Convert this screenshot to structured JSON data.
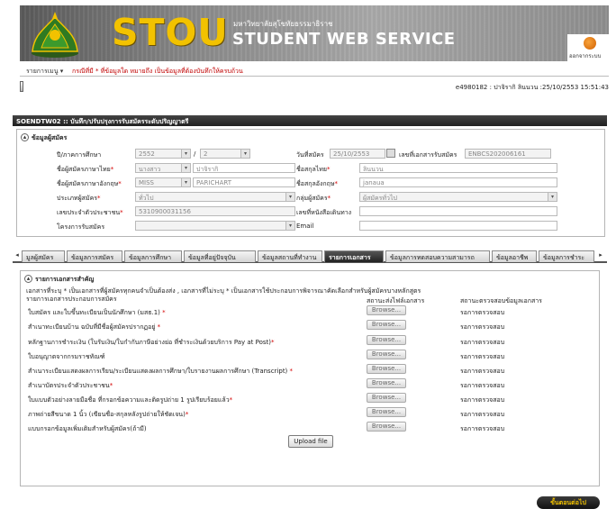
{
  "header": {
    "logo_text": "STOU",
    "university_th": "มหาวิทยาลัยสุโขทัยธรรมาธิราช",
    "service_title": "STUDENT WEB SERVICE",
    "logout_label": "ออกจากระบบ"
  },
  "menu": {
    "label": "รายการเมนู",
    "note": "กรณีที่มี * ที่ข้อมูลใด หมายถึง เป็นข้อมูลที่ต้องบันทึกให้ครบถ้วน"
  },
  "user_line": "e4980182 : ปาจิรากิ ลินนวน :25/10/2553 15:51:43",
  "page_title": "SOENDTW02 :: บันทึก/ปรับปรุงการรับสมัครระดับปริญญาตรี",
  "applicant": {
    "section_title": "ข้อมูลผู้สมัคร",
    "fields": {
      "academic_year_label": "ปี/ภาคการศึกษา",
      "academic_year_value": "2552",
      "semester_value": "2",
      "apply_date_label": "วันที่สมัคร",
      "apply_date_value": "25/10/2553",
      "doc_no_label": "เลขที่เอกสารรับสมัคร",
      "doc_no_value": "ENBCS202006161",
      "name_th_label": "ชื่อผู้สมัครภาษาไทย",
      "title_th_value": "นางสาว",
      "name_th_value": "ปาจิรากิ",
      "surname_th_label": "ชื่อสกุลไทย",
      "surname_th_value": "ลินนวน",
      "name_en_label": "ชื่อผู้สมัครภาษาอังกฤษ",
      "title_en_value": "MISS",
      "name_en_value": "PARICHART",
      "surname_en_label": "ชื่อสกุลอังกฤษ",
      "surname_en_value": "janaua",
      "type_label": "ประเภทผู้สมัคร",
      "type_value": "ทั่วไป",
      "group_label": "กลุ่มผู้สมัคร",
      "group_value": "ผู้สมัครทั่วไป",
      "id_label": "เลขประจำตัวประชาชน",
      "id_value": "5310900031156",
      "passport_label": "เลขที่หนังสือเดินทาง",
      "project_label": "โครงการรับสมัคร",
      "email_label": "Email"
    }
  },
  "tabs": [
    {
      "label": "มูลผู้สมัคร"
    },
    {
      "label": "ข้อมูลการสมัคร"
    },
    {
      "label": "ข้อมูลการศึกษา"
    },
    {
      "label": "ข้อมูลที่อยู่ปัจจุบัน"
    },
    {
      "label": "ข้อมูลสถานที่ทำงาน"
    },
    {
      "label": "รายการเอกสาร"
    },
    {
      "label": "ข้อมูลการทดสอบความสามารถ"
    },
    {
      "label": "ข้อมูลอาชีพ"
    },
    {
      "label": "ข้อมูลการชำระ"
    }
  ],
  "documents": {
    "section_title": "รายการเอกสารสำคัญ",
    "note": "เอกสารที่ระบุ * เป็นเอกสารที่ผู้สมัครทุกคนจำเป็นต้องส่ง , เอกสารที่ไม่ระบุ * เป็นเอกสารใช้ประกอบการพิจารณาคัดเลือกสำหรับผู้สมัครบางหลักสูตร",
    "col_list": "รายการเอกสารประกอบการสมัคร",
    "col_upload_status": "สถานะส่งไฟล์เอกสาร",
    "col_check_status": "สถานะตรวจสอบข้อมูลเอกสาร",
    "browse_label": "Browse...",
    "items": [
      {
        "name": "ใบสมัคร และใบขึ้นทะเบียนเป็นนักศึกษา (มสธ.1)",
        "required": true,
        "status": "รอการตรวจสอบ"
      },
      {
        "name": "สำเนาทะเบียนบ้าน ฉบับที่มีชื่อผู้สมัครปรากฏอยู่",
        "required": true,
        "status": "รอการตรวจสอบ"
      },
      {
        "name": "หลักฐานการชำระเงิน (ใบรับเงิน/ใบกำกับภาษีอย่างย่อ ที่ชำระเงินด้วยบริการ Pay at Post)",
        "required": true,
        "status": "รอการตรวจสอบ"
      },
      {
        "name": "ใบอนุญาตจากกรมราชทัณฑ์",
        "required": false,
        "status": "รอการตรวจสอบ"
      },
      {
        "name": "สำเนาระเบียนแสดงผลการเรียน/ระเบียนแสดงผลการศึกษา/ใบรายงานผลการศึกษา (Transcript)",
        "required": true,
        "status": "รอการตรวจสอบ"
      },
      {
        "name": "สำเนาบัตรประจำตัวประชาชน",
        "required": true,
        "status": "รอการตรวจสอบ"
      },
      {
        "name": "ใบแบบตัวอย่างลายมือชื่อ ที่กรอกข้อความและติดรูปถ่าย 1 รูปเรียบร้อยแล้ว",
        "required": true,
        "status": "รอการตรวจสอบ"
      },
      {
        "name": "ภาพถ่ายสีขนาด 1 นิ้ว (เขียนชื่อ-สกุลหลังรูปถ่ายให้ชัดเจน)",
        "required": true,
        "status": "รอการตรวจสอบ"
      },
      {
        "name": "แบบกรอกข้อมูลเพิ่มเติมสำหรับผู้สมัคร(ถ้ามี)",
        "required": false,
        "status": "รอการตรวจสอบ"
      }
    ],
    "upload_label": "Upload file"
  },
  "next_label": "ขั้นตอนต่อไป",
  "colors": {
    "accent_gold": "#f2c200",
    "required_red": "#d40000",
    "title_dark": "#1f1f1f"
  }
}
